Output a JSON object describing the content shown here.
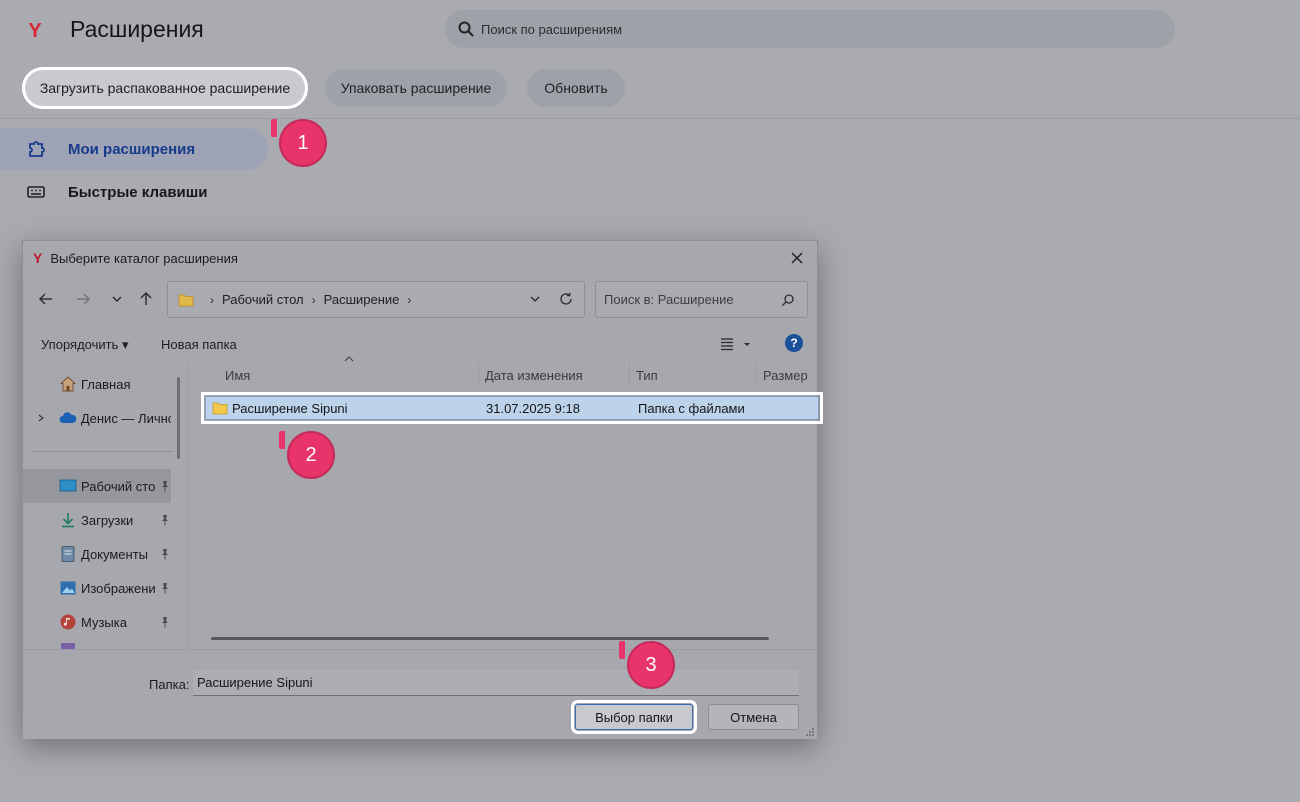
{
  "colors": {
    "accent": "#e8336b",
    "brand": "#d9273a",
    "selection": "#bcd3e9",
    "active_nav_text": "#173a8c"
  },
  "header": {
    "logo_icon": "yandex-logo",
    "title": "Расширения",
    "search_placeholder": "Поиск по расширениям",
    "search_icon": "search-icon"
  },
  "actions": {
    "load_unpacked": "Загрузить распакованное расширение",
    "pack": "Упаковать расширение",
    "refresh": "Обновить"
  },
  "sidebar": {
    "items": [
      {
        "label": "Мои расширения",
        "icon": "puzzle-icon",
        "active": true
      },
      {
        "label": "Быстрые клавиши",
        "icon": "keyboard-icon",
        "active": false
      }
    ]
  },
  "badges": [
    "1",
    "2",
    "3"
  ],
  "dialog": {
    "title": "Выберите каталог расширения",
    "breadcrumb": [
      "Рабочий стол",
      "Расширение"
    ],
    "search_placeholder": "Поиск в: Расширение",
    "toolbar": {
      "organize": "Упорядочить ▾",
      "new_folder": "Новая папка",
      "help": "?"
    },
    "tree": [
      {
        "label": "Главная",
        "icon": "home-icon",
        "pinned": false
      },
      {
        "label": "Денис — Личное",
        "icon": "cloud-icon",
        "pinned": false
      },
      {
        "label": "Рабочий стол",
        "icon": "desktop-icon",
        "pinned": true,
        "selected": true
      },
      {
        "label": "Загрузки",
        "icon": "download-icon",
        "pinned": true
      },
      {
        "label": "Документы",
        "icon": "document-icon",
        "pinned": true
      },
      {
        "label": "Изображения",
        "icon": "image-icon",
        "pinned": true
      },
      {
        "label": "Музыка",
        "icon": "music-icon",
        "pinned": true
      }
    ],
    "columns": [
      "Имя",
      "Дата изменения",
      "Тип",
      "Размер"
    ],
    "rows": [
      {
        "name": "Расширение Sipuni",
        "date": "31.07.2025 9:18",
        "type": "Папка с файлами",
        "size": ""
      }
    ],
    "folder_label": "Папка:",
    "folder_value": "Расширение Sipuni",
    "choose_button": "Выбор папки",
    "cancel_button": "Отмена"
  }
}
